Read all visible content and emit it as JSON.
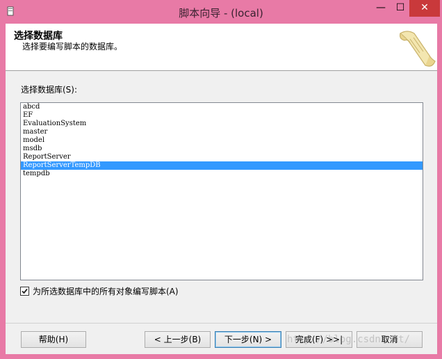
{
  "window": {
    "title": "脚本向导 - (local)",
    "controls": {
      "minimize": "—",
      "maximize": "☐",
      "close": "✕"
    }
  },
  "header": {
    "title": "选择数据库",
    "subtitle": "选择要编写脚本的数据库。"
  },
  "databases": {
    "label": "选择数据库(S):",
    "items": [
      "abcd",
      "EF",
      "EvaluationSystem",
      "master",
      "model",
      "msdb",
      "ReportServer",
      "ReportServerTempDB",
      "tempdb"
    ],
    "selected": "ReportServerTempDB"
  },
  "script_all_objects": {
    "label": "为所选数据库中的所有对象编写脚本(A)",
    "checked": true
  },
  "buttons": {
    "help": "帮助(H)",
    "prev": "< 上一步(B)",
    "next": "下一步(N) >",
    "finish": "完成(F) >>|",
    "cancel": "取消"
  },
  "watermark": "http://blog.csdn.net/",
  "colors": {
    "titlebar": "#e87aa6",
    "close_button": "#c9393b",
    "selection": "#3399ff"
  }
}
